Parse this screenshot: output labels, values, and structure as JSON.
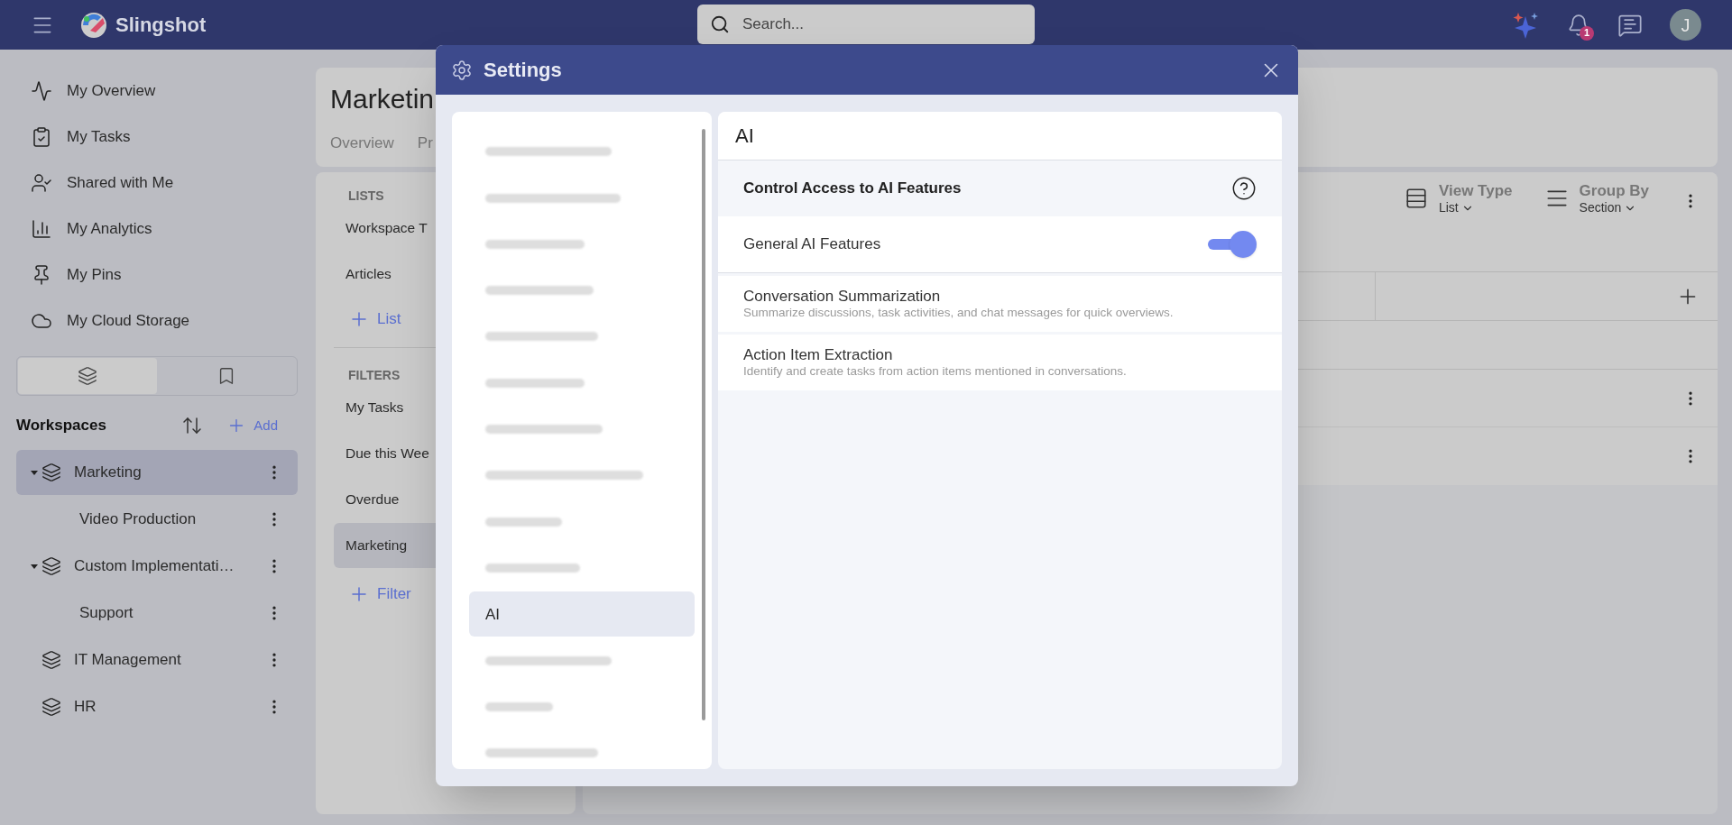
{
  "top_bar": {
    "app_name": "Slingshot",
    "search": {
      "placeholder": "Search..."
    },
    "notification_count": "1",
    "avatar_initial": "J"
  },
  "sidebar": {
    "nav_items": [
      {
        "label": "My Overview"
      },
      {
        "label": "My Tasks"
      },
      {
        "label": "Shared with Me"
      },
      {
        "label": "My Analytics"
      },
      {
        "label": "My Pins"
      },
      {
        "label": "My Cloud Storage"
      }
    ],
    "view_tabs": [
      {
        "selected": true
      },
      {
        "selected": false
      }
    ],
    "workspaces": {
      "title": "Workspaces",
      "add_label": "Add",
      "items": [
        {
          "label": "Marketing",
          "selected": true,
          "expanded": true,
          "children": [
            {
              "label": "Video Production",
              "selected": false
            }
          ]
        },
        {
          "label": "Custom Implementati…",
          "selected": false,
          "expanded": true,
          "children": [
            {
              "label": "Support",
              "selected": false
            }
          ]
        },
        {
          "label": "IT Management",
          "selected": false
        },
        {
          "label": "HR",
          "selected": false
        }
      ]
    }
  },
  "page": {
    "title": "Marketin",
    "tabs": [
      {
        "label": "Overview"
      },
      {
        "label": "Pr"
      }
    ]
  },
  "lists_panel": {
    "lists_heading": "LISTS",
    "lists": [
      "Workspace T",
      "Articles"
    ],
    "add_list": "List",
    "filters_heading": "FILTERS",
    "filters": [
      {
        "label": "My Tasks",
        "selected": false
      },
      {
        "label": "Due this Wee",
        "selected": false
      },
      {
        "label": "Overdue",
        "selected": false
      },
      {
        "label": "Marketing",
        "selected": true
      }
    ],
    "add_filter": "Filter"
  },
  "board": {
    "view_type": {
      "label": "View Type",
      "value": "List"
    },
    "group_by": {
      "label": "Group By",
      "value": "Section"
    }
  },
  "settings": {
    "title": "Settings",
    "nav": [
      {
        "kind": "blurred",
        "selected": false
      },
      {
        "kind": "blurred",
        "selected": false
      },
      {
        "kind": "blurred",
        "selected": false
      },
      {
        "kind": "blurred",
        "selected": false
      },
      {
        "kind": "blurred",
        "selected": false
      },
      {
        "kind": "blurred",
        "selected": false
      },
      {
        "kind": "blurred",
        "selected": false
      },
      {
        "kind": "blurred",
        "selected": false
      },
      {
        "kind": "blurred",
        "selected": false
      },
      {
        "kind": "blurred",
        "selected": false
      },
      {
        "kind": "text",
        "label": "AI",
        "selected": true
      },
      {
        "kind": "blurred",
        "selected": false
      },
      {
        "kind": "blurred",
        "selected": false
      },
      {
        "kind": "blurred",
        "selected": false
      }
    ],
    "section_title": "AI",
    "group_title": "Control Access to AI Features",
    "features": [
      {
        "kind": "toggle",
        "title": "General AI Features",
        "on": true
      },
      {
        "kind": "info",
        "title": "Conversation Summarization",
        "description": "Summarize discussions, task activities, and chat messages for quick overviews."
      },
      {
        "kind": "info",
        "title": "Action Item Extraction",
        "description": "Identify and create tasks from action items mentioned in conversations."
      }
    ]
  }
}
